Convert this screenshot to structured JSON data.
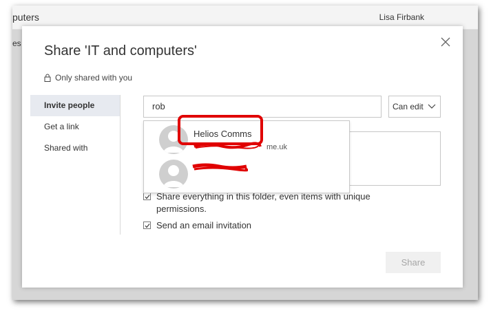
{
  "background": {
    "window_title": "puters",
    "user_name": "Lisa Firbank",
    "side_text": "es"
  },
  "dialog": {
    "title": "Share 'IT and computers'",
    "shared_status": "Only shared with you",
    "nav": [
      {
        "label": "Invite people",
        "active": true
      },
      {
        "label": "Get a link",
        "active": false
      },
      {
        "label": "Shared with",
        "active": false
      }
    ],
    "people_input_value": "rob",
    "permission": "Can edit",
    "checkboxes": [
      {
        "label": "Share everything in this folder, even items with unique permissions.",
        "checked": true
      },
      {
        "label": "Send an email invitation",
        "checked": true
      }
    ],
    "share_label": "Share"
  },
  "suggestions": [
    {
      "name": "Helios Comms",
      "email": "me.uk"
    },
    {
      "name": "",
      "email": ""
    }
  ],
  "colors": {
    "annotation_red": "#e00000",
    "nav_active_bg": "#e7eaf0"
  }
}
